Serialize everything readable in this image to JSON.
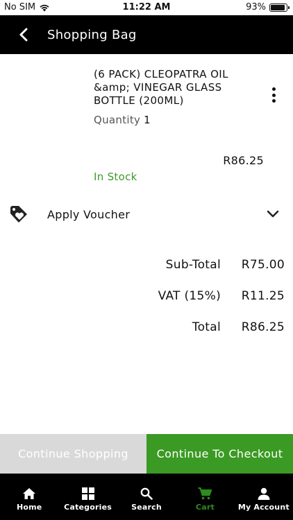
{
  "status_bar": {
    "carrier": "No SIM",
    "time": "11:22 AM",
    "battery": "93%",
    "battery_level": 0.93
  },
  "header": {
    "title": "Shopping Bag",
    "back_icon": "chevron-left-icon"
  },
  "cart_item": {
    "name": "(6 PACK) CLEOPATRA  OIL &amp; VINEGAR GLASS BOTTLE (200ML)",
    "quantity_label": "Quantity",
    "quantity": "1",
    "price": "R86.25",
    "stock_status": "In Stock",
    "menu_icon": "more-vertical-icon"
  },
  "voucher": {
    "label": "Apply Voucher",
    "icon": "tag-heart-icon",
    "toggle_icon": "chevron-down-icon"
  },
  "totals": {
    "subtotal_label": "Sub-Total",
    "subtotal": "R75.00",
    "vat_label": "VAT (15%)",
    "vat": "R11.25",
    "total_label": "Total",
    "total": "R86.25"
  },
  "actions": {
    "continue_label": "Continue Shopping",
    "checkout_label": "Continue To Checkout"
  },
  "bottom_nav": {
    "home": "Home",
    "categories": "Categories",
    "search": "Search",
    "cart": "Cart",
    "account": "My Account",
    "active": "Cart"
  },
  "colors": {
    "header_bg": "#000000",
    "accent_green": "#3b9a24",
    "in_stock_green": "#3e9a2d",
    "disabled_button": "#d9d9d9"
  }
}
